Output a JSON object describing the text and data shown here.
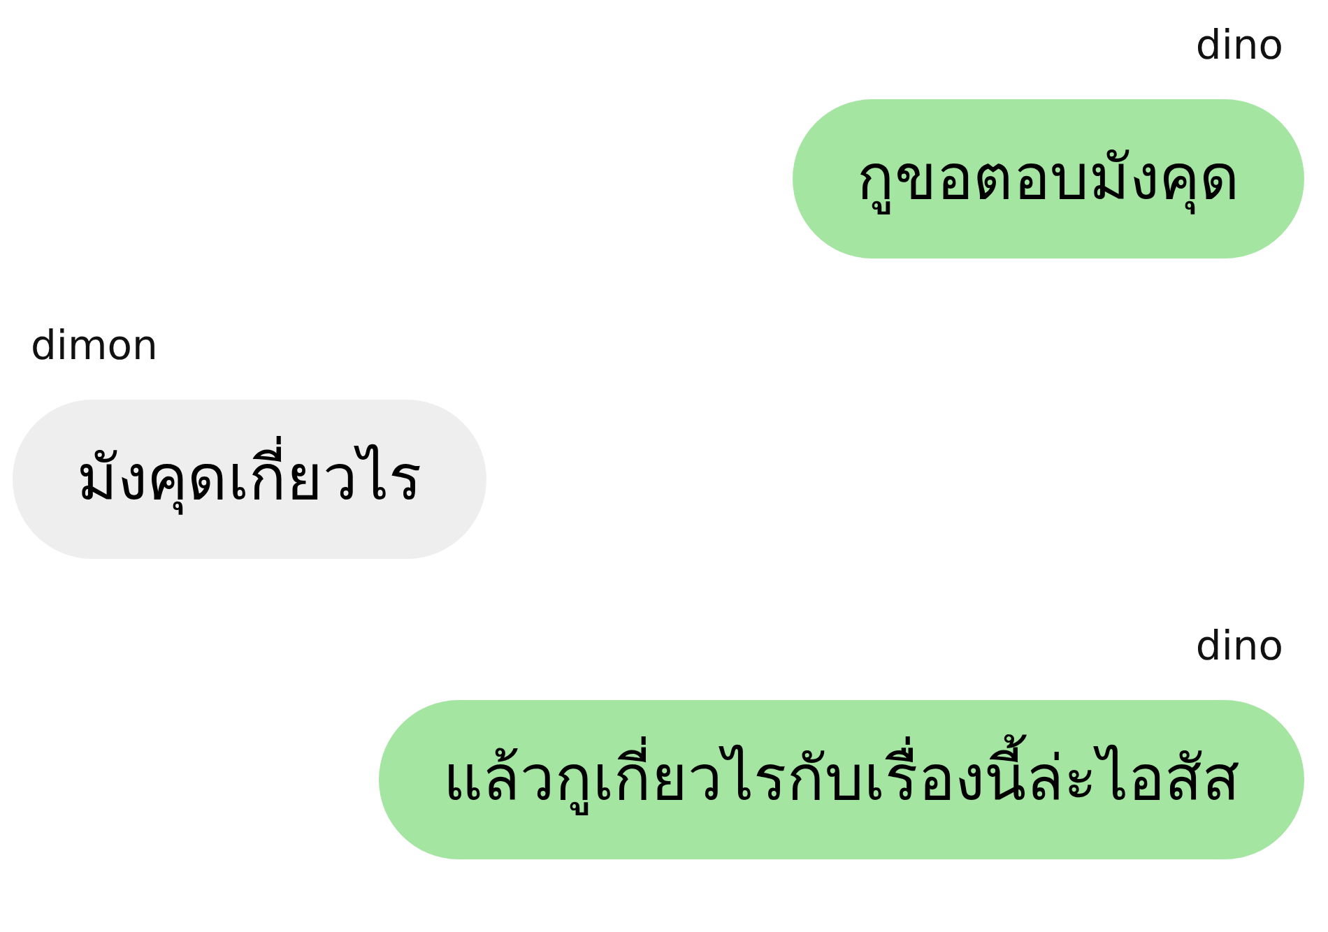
{
  "messages": [
    {
      "kind": "sent",
      "sender": "dino",
      "text": "กูขอตอบมังคุด"
    },
    {
      "kind": "received",
      "sender": "dimon",
      "text": "มังคุดเกี่ยวไร"
    },
    {
      "kind": "sent",
      "sender": "dino",
      "text": "แล้วกูเกี่ยวไรกับเรื่องนี้ล่ะไอสัส"
    }
  ]
}
